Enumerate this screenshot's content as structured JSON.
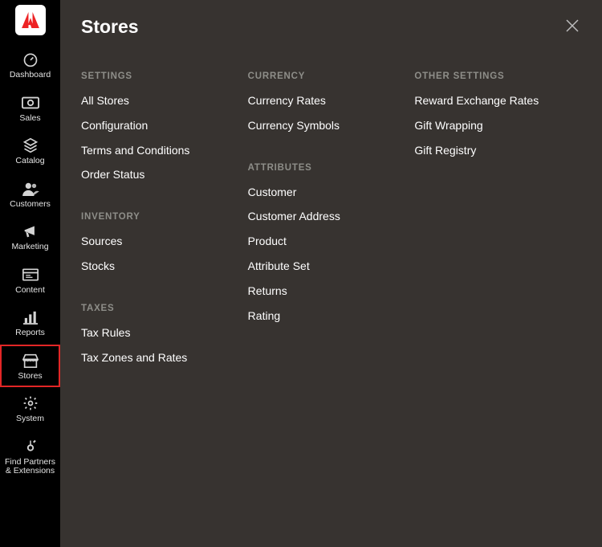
{
  "sidebar": {
    "items": [
      {
        "label": "Dashboard",
        "icon": "dashboard-icon"
      },
      {
        "label": "Sales",
        "icon": "sales-icon"
      },
      {
        "label": "Catalog",
        "icon": "catalog-icon"
      },
      {
        "label": "Customers",
        "icon": "customers-icon"
      },
      {
        "label": "Marketing",
        "icon": "marketing-icon"
      },
      {
        "label": "Content",
        "icon": "content-icon"
      },
      {
        "label": "Reports",
        "icon": "reports-icon"
      },
      {
        "label": "Stores",
        "icon": "stores-icon",
        "active": true
      },
      {
        "label": "System",
        "icon": "system-icon"
      },
      {
        "label": "Find Partners & Extensions",
        "icon": "partners-icon"
      }
    ]
  },
  "flyout": {
    "title": "Stores",
    "columns": [
      {
        "sections": [
          {
            "heading": "SETTINGS",
            "links": [
              "All Stores",
              "Configuration",
              "Terms and Conditions",
              "Order Status"
            ]
          },
          {
            "heading": "INVENTORY",
            "links": [
              "Sources",
              "Stocks"
            ]
          },
          {
            "heading": "TAXES",
            "links": [
              "Tax Rules",
              "Tax Zones and Rates"
            ]
          }
        ]
      },
      {
        "sections": [
          {
            "heading": "CURRENCY",
            "links": [
              "Currency Rates",
              "Currency Symbols"
            ]
          },
          {
            "heading": "ATTRIBUTES",
            "links": [
              "Customer",
              "Customer Address",
              "Product",
              "Attribute Set",
              "Returns",
              "Rating"
            ]
          }
        ]
      },
      {
        "sections": [
          {
            "heading": "OTHER SETTINGS",
            "links": [
              "Reward Exchange Rates",
              "Gift Wrapping",
              "Gift Registry"
            ]
          }
        ]
      }
    ]
  }
}
